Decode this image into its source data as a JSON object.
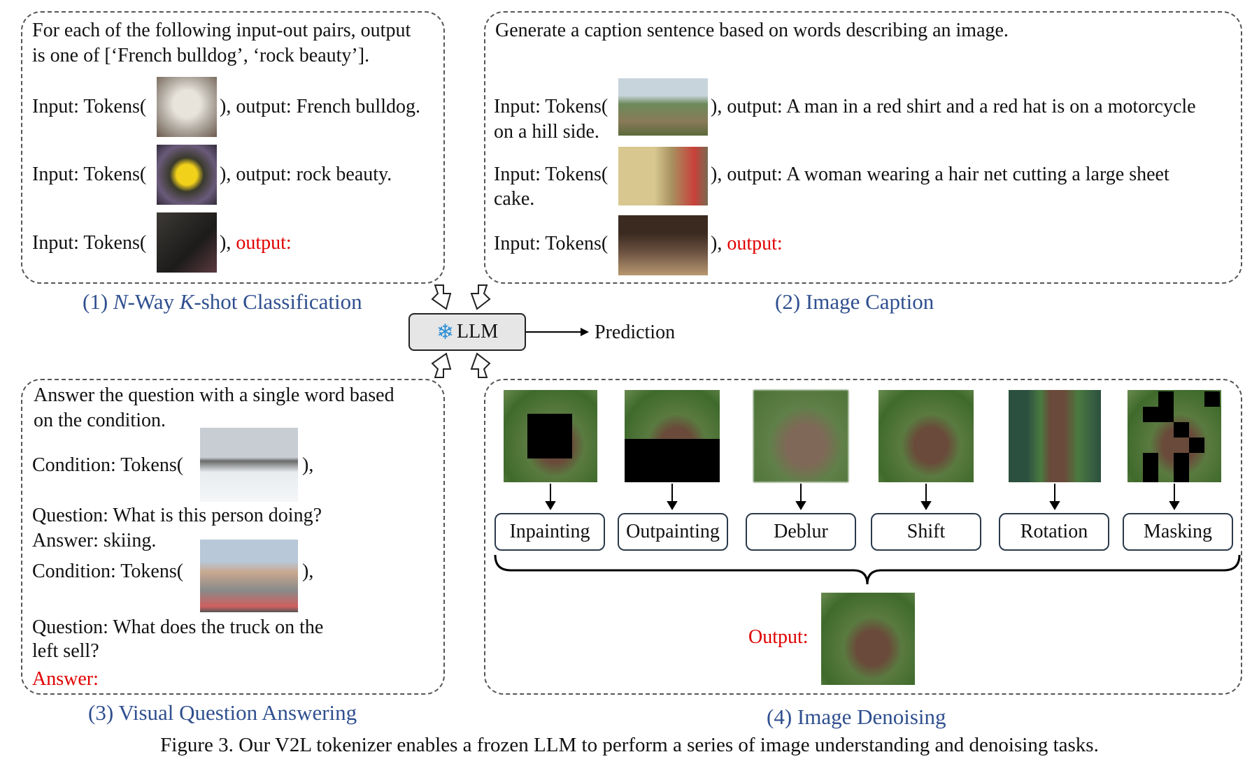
{
  "panel1": {
    "intro_line1": "For each of the following input-out pairs, output",
    "intro_line2": "is one of [‘French bulldog’, ‘rock beauty’].",
    "rows": [
      {
        "prefix": "Input: Tokens(",
        "suffix": "), output: French bulldog."
      },
      {
        "prefix": "Input: Tokens(",
        "suffix": "), output: rock beauty."
      },
      {
        "prefix": "Input: Tokens(",
        "suffix_black": "), ",
        "suffix_red": "output:"
      }
    ],
    "caption_num": "(1) ",
    "caption_n": "N",
    "caption_way": "-Way ",
    "caption_k": "K",
    "caption_rest": "-shot Classification"
  },
  "panel2": {
    "intro": "Generate a caption sentence based on words describing an image.",
    "rows": [
      {
        "prefix": "Input: Tokens(",
        "suffix": "), output: A man in a red shirt and a red hat is on a motorcycle",
        "cont": "on a hill side."
      },
      {
        "prefix": "Input: Tokens(",
        "suffix": "), output: A woman wearing a hair net cutting a large sheet",
        "cont": "cake."
      },
      {
        "prefix": "Input: Tokens(",
        "suffix_black": "), ",
        "suffix_red": "output:"
      }
    ],
    "caption": "(2) Image Caption"
  },
  "center": {
    "llm_label": "LLM",
    "prediction": "Prediction",
    "snowflake": "❄"
  },
  "panel3": {
    "intro_line1": "Answer the question with a single word based",
    "intro_line2": "on the condition.",
    "cond1": "Condition: Tokens(",
    "close1": "),",
    "q1": "Question: What is this person doing?",
    "a1": "Answer: skiing.",
    "cond2": "Condition: Tokens(",
    "close2": "),",
    "q2_line1": "Question: What does the truck on the",
    "q2_line2": "left sell?",
    "answer": "Answer:",
    "caption": "(3) Visual Question Answering"
  },
  "panel4": {
    "ops": [
      "Inpainting",
      "Outpainting",
      "Deblur",
      "Shift",
      "Rotation",
      "Masking"
    ],
    "output_label": "Output:",
    "caption": "(4) Image Denoising"
  },
  "figure_caption": "Figure 3. Our V2L tokenizer enables a frozen LLM to perform a series of image understanding and denoising tasks.",
  "colors": {
    "caption_blue": "#2f4f8f",
    "highlight_red": "#e00000"
  }
}
